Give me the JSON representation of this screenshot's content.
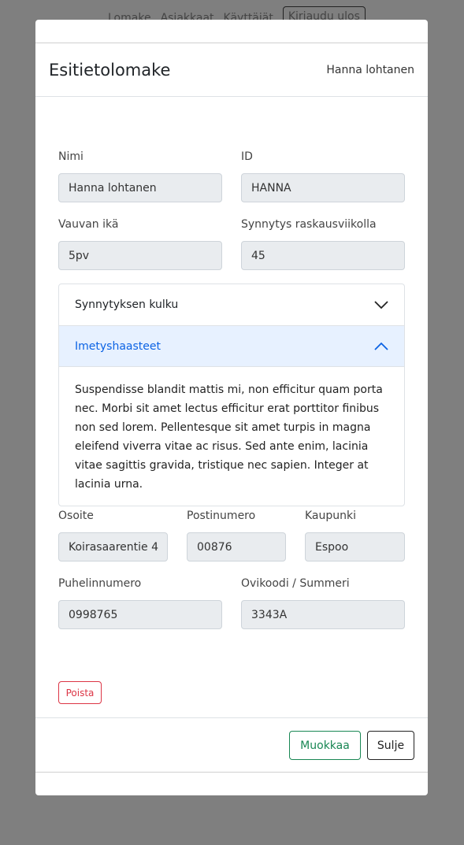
{
  "nav": {
    "items": [
      "Lomake",
      "Asiakkaat",
      "Käyttäjät"
    ],
    "logout": "Kirjaudu ulos"
  },
  "modal": {
    "title": "Esitietolomake",
    "user": "Hanna lohtanen"
  },
  "fields": {
    "nimi": {
      "label": "Nimi",
      "value": "Hanna lohtanen"
    },
    "id": {
      "label": "ID",
      "value": "HANNA"
    },
    "ika": {
      "label": "Vauvan ikä",
      "value": "5pv"
    },
    "viikko": {
      "label": "Synnytys raskausviikolla",
      "value": "45"
    },
    "osoite": {
      "label": "Osoite",
      "value": "Koirasaarentie 4"
    },
    "postinumero": {
      "label": "Postinumero",
      "value": "00876"
    },
    "kaupunki": {
      "label": "Kaupunki",
      "value": "Espoo"
    },
    "puhelin": {
      "label": "Puhelinnumero",
      "value": "0998765"
    },
    "ovikoodi": {
      "label": "Ovikoodi / Summeri",
      "value": "3343A"
    }
  },
  "accordion": [
    {
      "title": "Synnytyksen kulku",
      "expanded": false
    },
    {
      "title": "Imetyshaasteet",
      "expanded": true,
      "body": "Suspendisse blandit mattis mi, non efficitur quam porta nec. Morbi sit amet lectus efficitur erat porttitor finibus non sed lorem. Pellentesque sit amet turpis in magna eleifend viverra vitae ac risus. Sed ante enim, lacinia vitae sagittis gravida, tristique nec sapien. Integer at lacinia urna."
    }
  ],
  "buttons": {
    "delete": "Poista",
    "edit": "Muokkaa",
    "close": "Sulje"
  },
  "colors": {
    "danger": "#dc3545",
    "success": "#198754",
    "accent": "#0c63e4"
  }
}
